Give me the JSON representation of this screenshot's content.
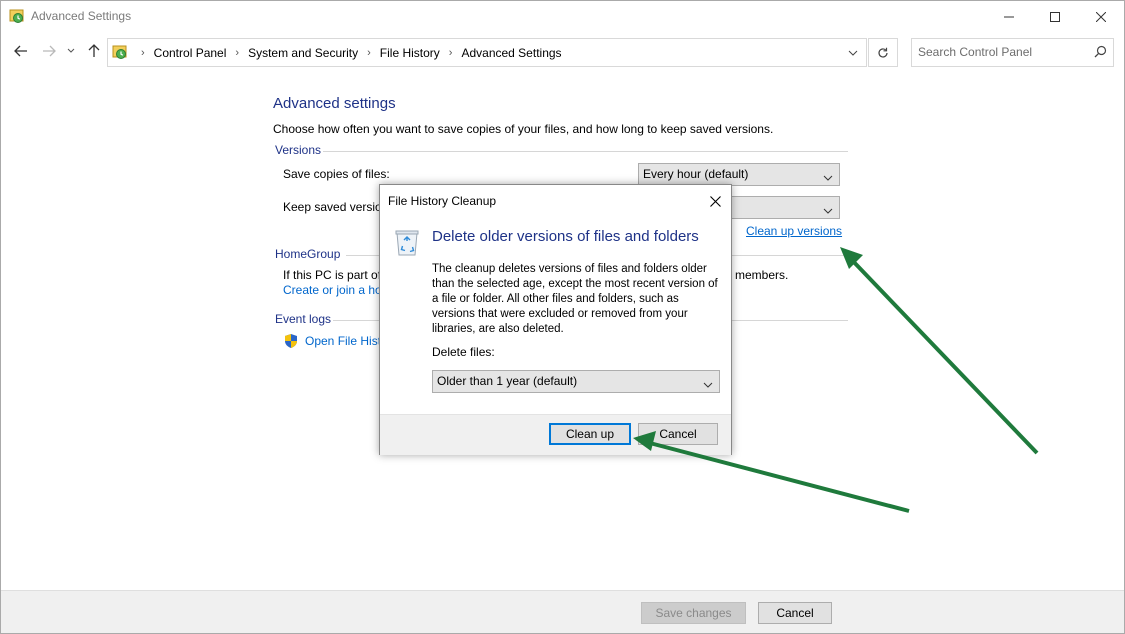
{
  "window": {
    "title": "Advanced Settings"
  },
  "address_bar": {
    "breadcrumbs": [
      "Control Panel",
      "System and Security",
      "File History",
      "Advanced Settings"
    ]
  },
  "search": {
    "placeholder": "Search Control Panel"
  },
  "page": {
    "heading": "Advanced settings",
    "description": "Choose how often you want to save copies of your files, and how long to keep saved versions.",
    "versions": {
      "section_title": "Versions",
      "save_copies_label": "Save copies of files:",
      "save_copies_value": "Every hour (default)",
      "keep_versions_label": "Keep saved versions:",
      "cleanup_link": "Clean up versions"
    },
    "homegroup": {
      "section_title": "HomeGroup",
      "text": "If this PC is part of",
      "text_tail": "members.",
      "link": "Create or join a ho"
    },
    "event_logs": {
      "section_title": "Event logs",
      "link": "Open File Hist"
    }
  },
  "footer": {
    "save_label": "Save changes",
    "cancel_label": "Cancel"
  },
  "dialog": {
    "title": "File History Cleanup",
    "heading": "Delete older versions of files and folders",
    "paragraph": "The cleanup deletes versions of files and folders older than the selected age, except the most recent version of a file or folder. All other files and folders, such as versions that were excluded or removed from your libraries, are also deleted.",
    "delete_label": "Delete files:",
    "delete_value": "Older than 1 year (default)",
    "cleanup_label": "Clean up",
    "cancel_label": "Cancel"
  },
  "colors": {
    "heading_blue": "#1e3287",
    "link_blue": "#0066cc",
    "focus_blue": "#0078d7",
    "annotation_green": "#1f7a3c"
  }
}
